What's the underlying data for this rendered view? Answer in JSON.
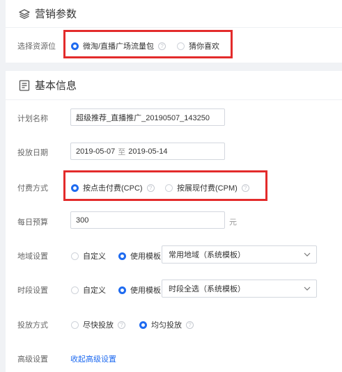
{
  "marketing": {
    "title": "营销参数",
    "resource_label": "选择资源位",
    "options": [
      "微淘/直播广场流量包",
      "猜你喜欢"
    ],
    "selected": 0
  },
  "basic": {
    "title": "基本信息",
    "plan_name_label": "计划名称",
    "plan_name_value": "超级推荐_直播推广_20190507_143250",
    "date_label": "投放日期",
    "date_start": "2019-05-07",
    "date_sep": "至",
    "date_end": "2019-05-14",
    "pay_label": "付费方式",
    "pay_options": [
      "按点击付费(CPC)",
      "按展现付费(CPM)"
    ],
    "pay_selected": 0,
    "budget_label": "每日预算",
    "budget_value": "300",
    "budget_unit": "元",
    "region_label": "地域设置",
    "region_options": [
      "自定义",
      "使用模板"
    ],
    "region_selected": 1,
    "region_template": "常用地域（系统模板）",
    "time_label": "时段设置",
    "time_options": [
      "自定义",
      "使用模板"
    ],
    "time_selected": 1,
    "time_template": "时段全选（系统模板）",
    "delivery_label": "投放方式",
    "delivery_options": [
      "尽快投放",
      "均匀投放"
    ],
    "delivery_selected": 1,
    "advanced_label": "高级设置",
    "advanced_link": "收起高级设置"
  },
  "colors": {
    "accent": "#1f6bf0",
    "highlight": "#e32b2b"
  }
}
